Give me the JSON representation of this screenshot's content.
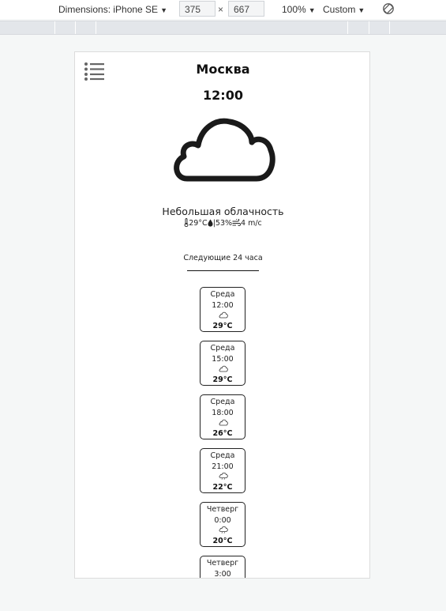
{
  "devtools": {
    "dimensions_label": "Dimensions: iPhone SE",
    "width": "375",
    "times": "×",
    "height": "667",
    "zoom": "100%",
    "throttle": "Custom",
    "rotate_icon": "rotate-icon"
  },
  "weather": {
    "city": "Москва",
    "time": "12:00",
    "main_icon": "cloud-icon",
    "description": "Небольшая облачность",
    "temperature": "29°C",
    "humidity": "53%",
    "wind": "4 m/c",
    "next_title": "Следующие 24 часа",
    "hours": [
      {
        "day": "Среда",
        "hour": "12:00",
        "icon": "cloud-icon",
        "temp": "29°C"
      },
      {
        "day": "Среда",
        "hour": "15:00",
        "icon": "cloud-icon",
        "temp": "29°C"
      },
      {
        "day": "Среда",
        "hour": "18:00",
        "icon": "cloud-icon",
        "temp": "26°C"
      },
      {
        "day": "Среда",
        "hour": "21:00",
        "icon": "cloud-rain-icon",
        "temp": "22°C"
      },
      {
        "day": "Четверг",
        "hour": "0:00",
        "icon": "cloud-rain-icon",
        "temp": "20°C"
      },
      {
        "day": "Четверг",
        "hour": "3:00",
        "icon": "cloud-icon",
        "temp": ""
      }
    ]
  }
}
